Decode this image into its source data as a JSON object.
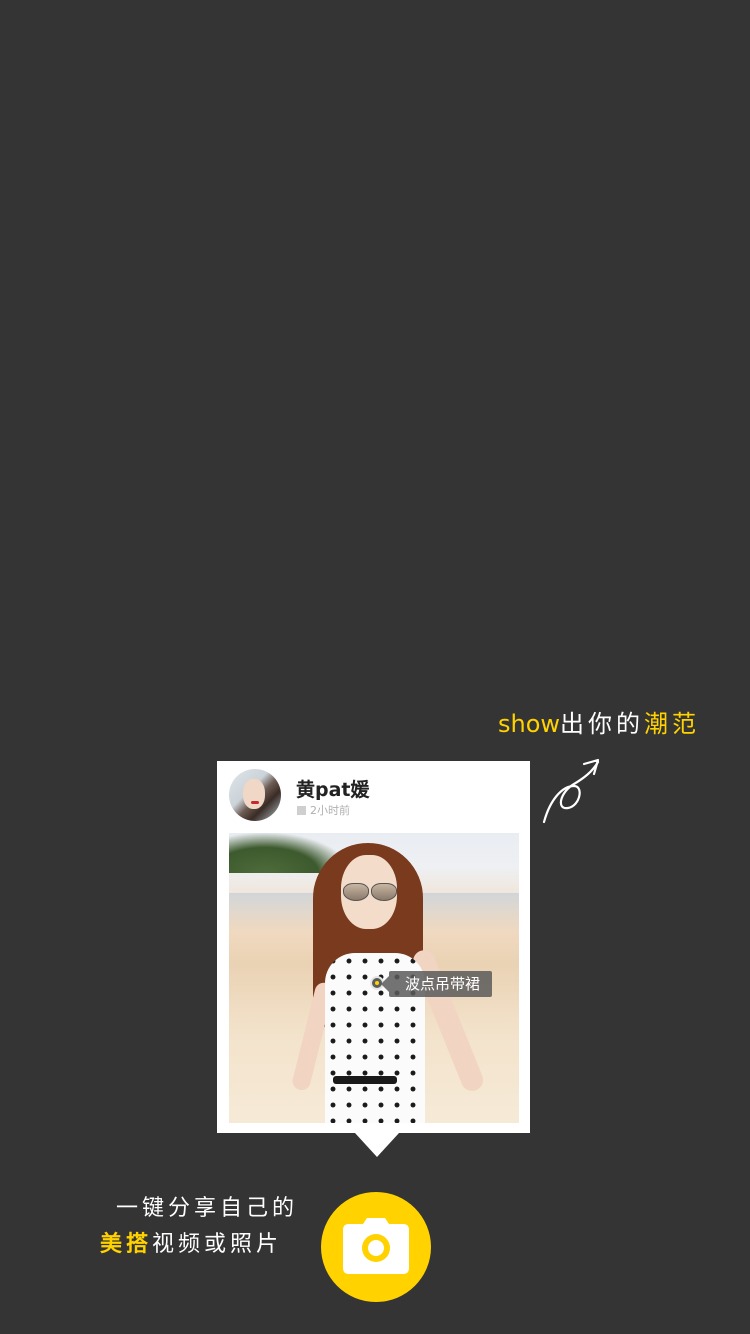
{
  "colors": {
    "background": "#343434",
    "accent": "#ffd200",
    "card": "#ffffff"
  },
  "tagline": {
    "lead": "show",
    "middle": "出你的",
    "highlight": "潮范"
  },
  "post": {
    "username": "黄pat媛",
    "time": "2小时前",
    "tag_label": "波点吊带裙"
  },
  "caption": {
    "line1": "一键分享自己的",
    "line2_highlight": "美搭",
    "line2_rest": "视频或照片"
  },
  "icons": {
    "arrow": "curly-arrow-icon",
    "camera": "camera-icon",
    "clock": "clock-icon"
  }
}
